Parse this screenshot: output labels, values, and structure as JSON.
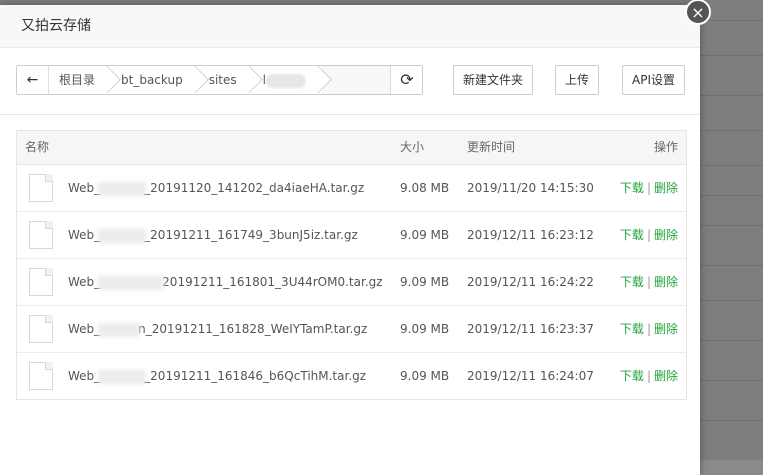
{
  "dialog": {
    "title": "又拍云存储",
    "close_symbol": "×"
  },
  "toolbar": {
    "back_symbol": "←",
    "refresh_symbol": "⟳",
    "breadcrumbs": [
      "根目录",
      "bt_backup",
      "sites",
      "l"
    ],
    "new_folder_label": "新建文件夹",
    "upload_label": "上传",
    "api_settings_label": "API设置"
  },
  "table": {
    "headers": {
      "name": "名称",
      "size": "大小",
      "time": "更新时间",
      "op": "操作"
    },
    "rows": [
      {
        "name_prefix": "Web_",
        "name_suffix": "_20191120_141202_da4iaeHA.tar.gz",
        "size": "9.08 MB",
        "time": "2019/11/20 14:15:30"
      },
      {
        "name_prefix": "Web_",
        "name_suffix": "_20191211_161749_3bunJ5iz.tar.gz",
        "size": "9.09 MB",
        "time": "2019/12/11 16:23:12"
      },
      {
        "name_prefix": "Web_",
        "name_suffix": "20191211_161801_3U44rOM0.tar.gz",
        "size": "9.09 MB",
        "time": "2019/12/11 16:24:22"
      },
      {
        "name_prefix": "Web_",
        "name_suffix": "n_20191211_161828_WeIYTamP.tar.gz",
        "size": "9.09 MB",
        "time": "2019/12/11 16:23:37"
      },
      {
        "name_prefix": "Web_",
        "name_suffix": "_20191211_161846_b6QcTihM.tar.gz",
        "size": "9.09 MB",
        "time": "2019/12/11 16:24:07"
      }
    ],
    "download_label": "下载",
    "delete_label": "删除",
    "op_separator": "|"
  },
  "colors": {
    "link": "#20a53a",
    "overlay": "#7e7e7e"
  }
}
